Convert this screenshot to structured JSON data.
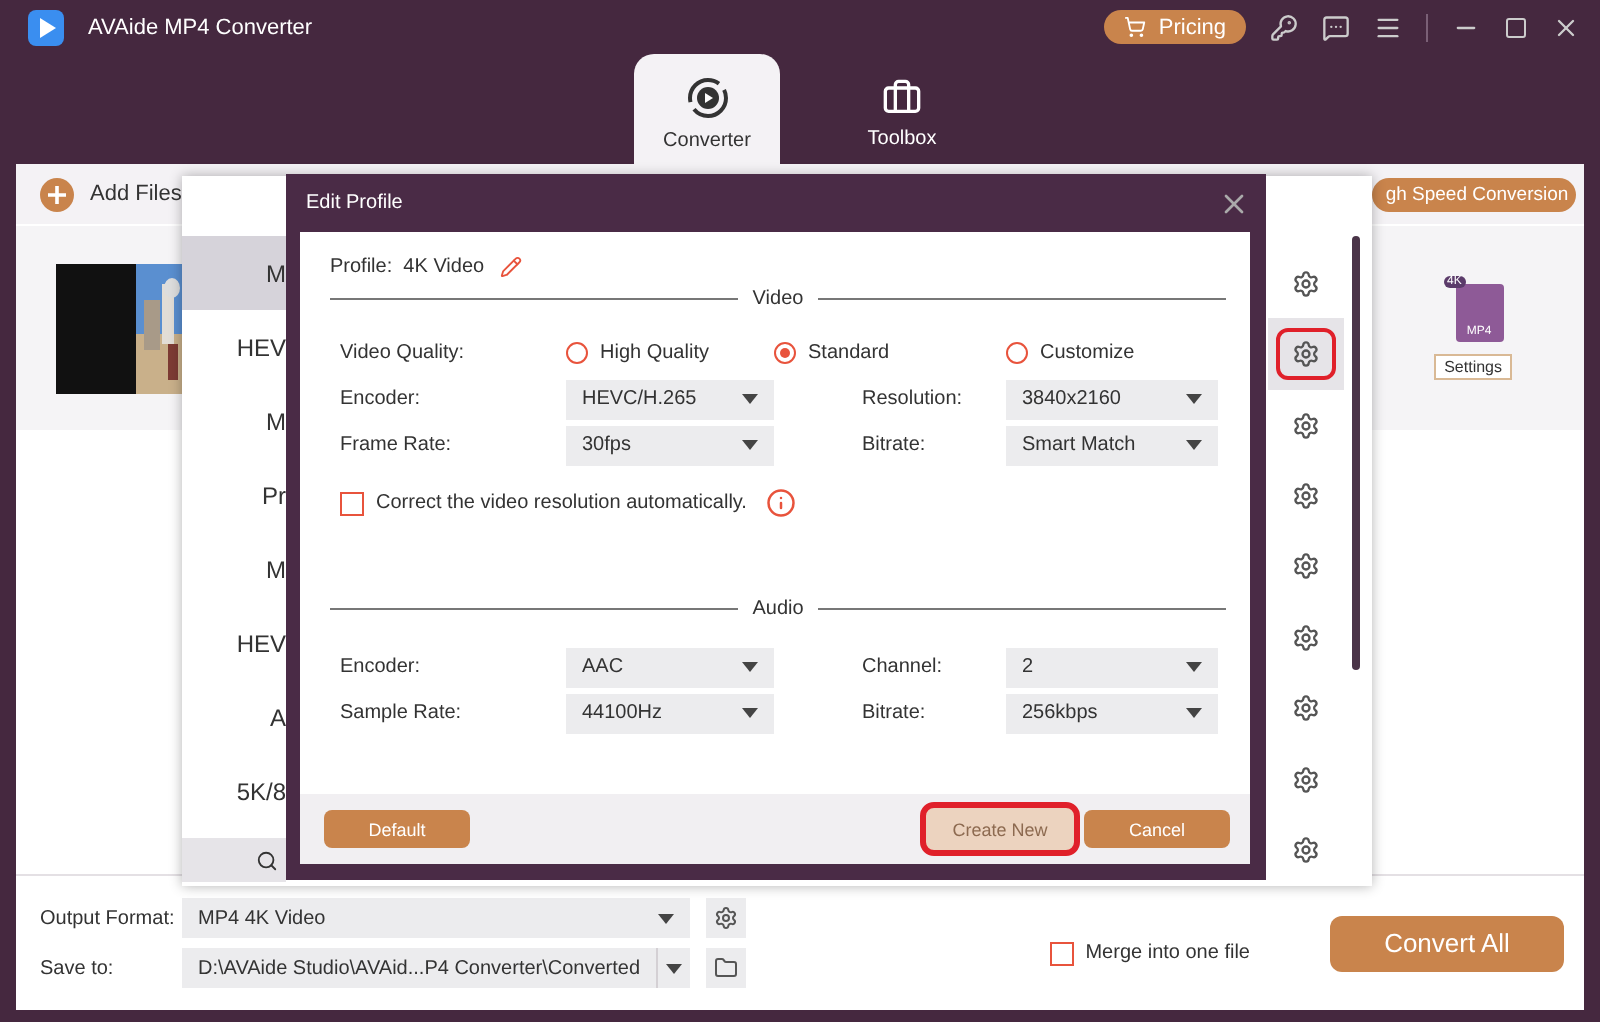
{
  "app": {
    "title": "AVAide MP4 Converter",
    "pricing": "Pricing"
  },
  "tabs": [
    {
      "label": "Converter",
      "selected": true
    },
    {
      "label": "Toolbox",
      "selected": false
    }
  ],
  "toolbar": {
    "add_files": "Add Files",
    "speed_button": "gh Speed Conversion"
  },
  "file": {
    "format_badge": "4K",
    "format": "MP4",
    "settings": "Settings"
  },
  "format_list": {
    "items": [
      {
        "label": "M",
        "selected": true
      },
      {
        "label": "HEV",
        "selected": false
      },
      {
        "label": "M",
        "selected": false
      },
      {
        "label": "Pr",
        "selected": false
      },
      {
        "label": "M",
        "selected": false
      },
      {
        "label": "HEV",
        "selected": false
      },
      {
        "label": "A",
        "selected": false
      },
      {
        "label": "5K/8",
        "selected": false
      }
    ],
    "gears": [
      {
        "selected": false,
        "highlighted": false
      },
      {
        "selected": true,
        "highlighted": true
      },
      {
        "selected": false,
        "highlighted": false
      },
      {
        "selected": false,
        "highlighted": false
      },
      {
        "selected": false,
        "highlighted": false
      },
      {
        "selected": false,
        "highlighted": false
      },
      {
        "selected": false,
        "highlighted": false
      },
      {
        "selected": false,
        "highlighted": false
      },
      {
        "selected": false,
        "highlighted": false
      }
    ]
  },
  "dialog": {
    "title": "Edit Profile",
    "profile": "Profile:  4K Video",
    "video_section": "Video",
    "quality_label": "Video Quality:",
    "quality_options": [
      {
        "label": "High Quality",
        "selected": false
      },
      {
        "label": "Standard",
        "selected": true
      },
      {
        "label": "Customize",
        "selected": false
      }
    ],
    "video_fields": [
      {
        "label": "Encoder:",
        "value": "HEVC/H.265"
      },
      {
        "label": "Resolution:",
        "value": "3840x2160"
      },
      {
        "label": "Frame Rate:",
        "value": "30fps"
      },
      {
        "label": "Bitrate:",
        "value": "Smart Match"
      }
    ],
    "auto_correct": {
      "label": "Correct the video resolution automatically.",
      "checked": false
    },
    "audio_section": "Audio",
    "audio_fields": [
      {
        "label": "Encoder:",
        "value": "AAC"
      },
      {
        "label": "Channel:",
        "value": "2"
      },
      {
        "label": "Sample Rate:",
        "value": "44100Hz"
      },
      {
        "label": "Bitrate:",
        "value": "256kbps"
      }
    ],
    "buttons": [
      {
        "label": "Default",
        "kind": "default",
        "disabled": false,
        "highlighted": false
      },
      {
        "label": "Create New",
        "kind": "create",
        "disabled": true,
        "highlighted": true
      },
      {
        "label": "Cancel",
        "kind": "cancel",
        "disabled": false,
        "highlighted": false
      }
    ]
  },
  "bottom": {
    "output_format_label": "Output Format:",
    "output_format": "MP4 4K Video",
    "save_to_label": "Save to:",
    "save_path": "D:\\AVAide Studio\\AVAid...P4 Converter\\Converted",
    "merge": {
      "label": "Merge into one file",
      "checked": false
    },
    "convert_all": "Convert All"
  }
}
